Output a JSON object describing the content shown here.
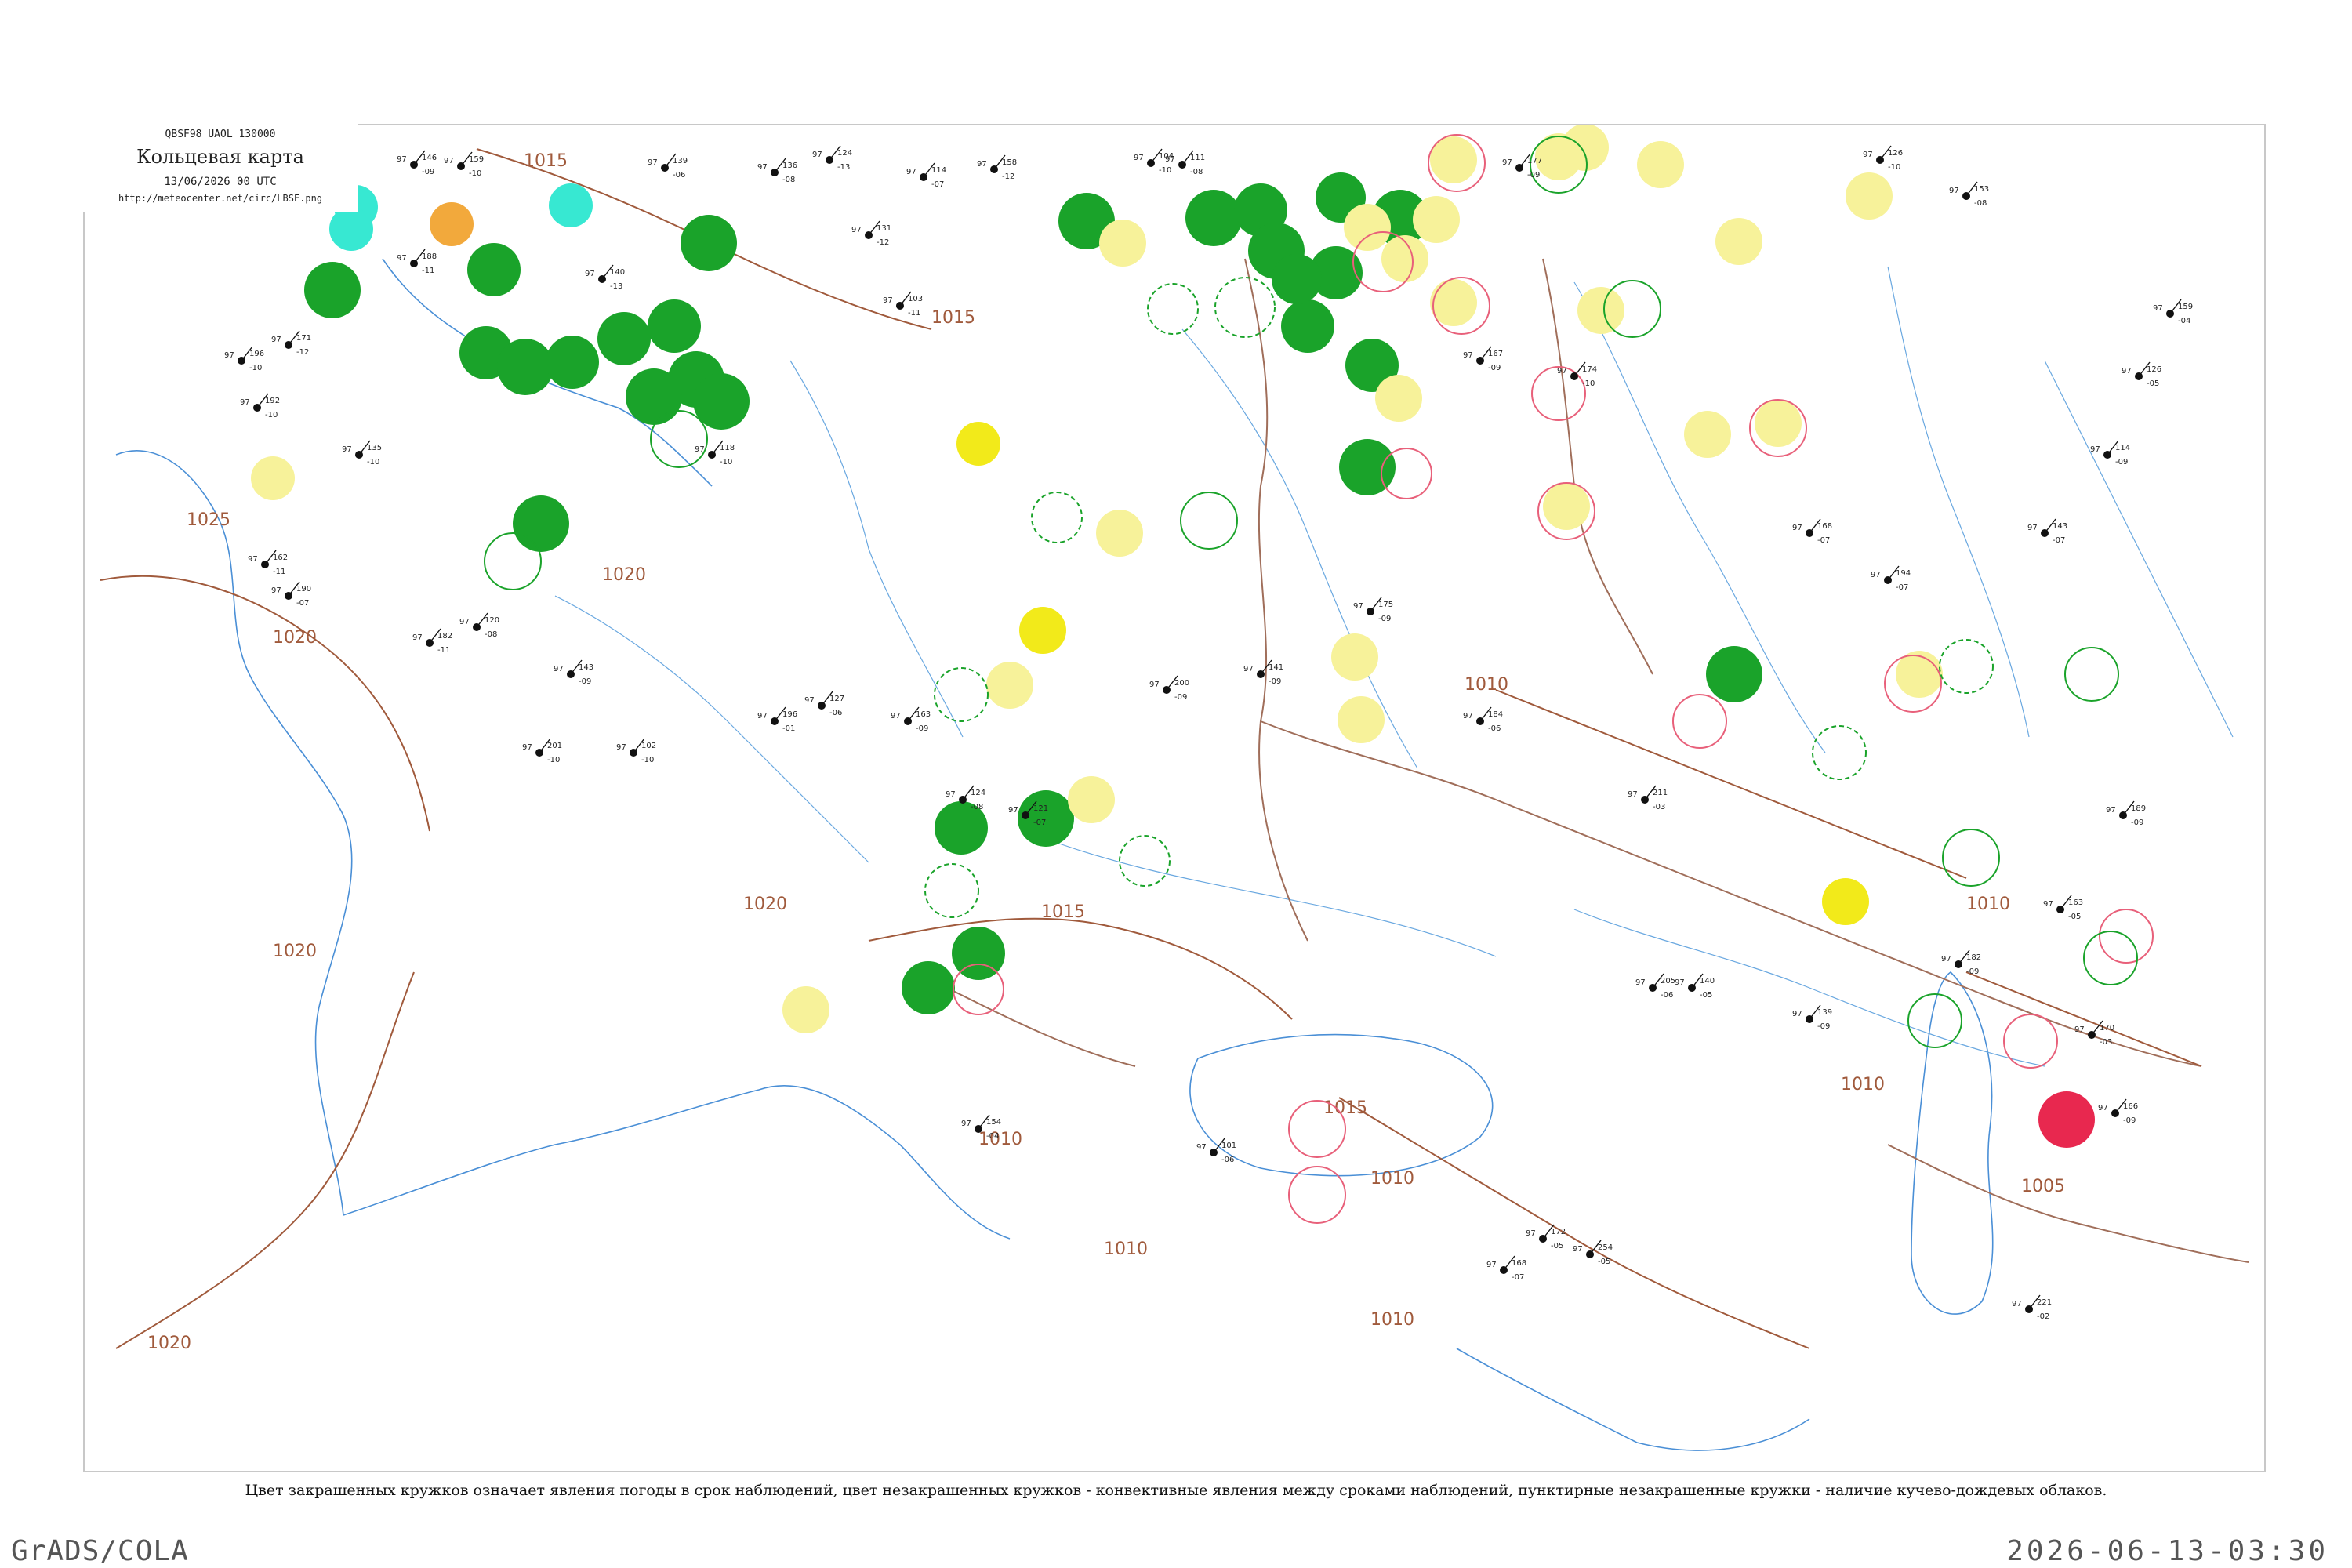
{
  "header": {
    "code": "QBSF98  UAOL  130000",
    "title": "Кольцевая карта",
    "datetime": "13/06/2026 00 UTC",
    "url": "http://meteocenter.net/circ/LBSF.png"
  },
  "caption": "Цвет закрашенных кружков означает явления погоды в срок наблюдений, цвет незакрашенных кружков - конвективные явления между сроками наблюдений, пунктирные незакрашенные кружки - наличие кучево-дождевых облаков.",
  "footer": {
    "software": "GrADS/COLA",
    "timestamp": "2026-06-13-03:30"
  },
  "colors": {
    "rain": "#1aa32a",
    "fog": "#f2ea1a",
    "haze": "#f7f29a",
    "snow": "#37e8d2",
    "dust": "#f2a93c",
    "thunder": "#e8284f",
    "isobar": "#a05a3c",
    "river": "#6aa8e0",
    "coast": "#4a8fd6"
  },
  "isobars": [
    {
      "label": "1015"
    },
    {
      "label": "1015"
    },
    {
      "label": "1015"
    },
    {
      "label": "1015"
    },
    {
      "label": "1020"
    },
    {
      "label": "1020"
    },
    {
      "label": "1020"
    },
    {
      "label": "1020"
    },
    {
      "label": "1020"
    },
    {
      "label": "1025"
    },
    {
      "label": "1010"
    },
    {
      "label": "1010"
    },
    {
      "label": "1010"
    },
    {
      "label": "1010"
    },
    {
      "label": "1010"
    },
    {
      "label": "1010"
    },
    {
      "label": "1010"
    },
    {
      "label": "1005"
    }
  ],
  "stations": [
    {
      "p": "146",
      "t": "09",
      "d": "97"
    },
    {
      "p": "159",
      "t": "10",
      "d": "97"
    },
    {
      "p": "139",
      "t": "06",
      "d": "97"
    },
    {
      "p": "136",
      "t": "08",
      "d": "97"
    },
    {
      "p": "124",
      "t": "13",
      "d": "97"
    },
    {
      "p": "114",
      "t": "07",
      "d": "97"
    },
    {
      "p": "158",
      "t": "12",
      "d": "97"
    },
    {
      "p": "104",
      "t": "10",
      "d": "97"
    },
    {
      "p": "111",
      "t": "08",
      "d": "97"
    },
    {
      "p": "177",
      "t": "09",
      "d": "97"
    },
    {
      "p": "126",
      "t": "10",
      "d": "97"
    },
    {
      "p": "153",
      "t": "08",
      "d": "97"
    },
    {
      "p": "188",
      "t": "11",
      "d": "97"
    },
    {
      "p": "140",
      "t": "13",
      "d": "97"
    },
    {
      "p": "131",
      "t": "12",
      "d": "97"
    },
    {
      "p": "103",
      "t": "11",
      "d": "97"
    },
    {
      "p": "167",
      "t": "09",
      "d": "97"
    },
    {
      "p": "174",
      "t": "10",
      "d": "97"
    },
    {
      "p": "196",
      "t": "10",
      "d": "97"
    },
    {
      "p": "171",
      "t": "12",
      "d": "97"
    },
    {
      "p": "118",
      "t": "10",
      "d": "97"
    },
    {
      "p": "192",
      "t": "10",
      "d": "97"
    },
    {
      "p": "135",
      "t": "10",
      "d": "97"
    },
    {
      "p": "162",
      "t": "11",
      "d": "97"
    },
    {
      "p": "190",
      "t": "07",
      "d": "97"
    },
    {
      "p": "182",
      "t": "11",
      "d": "97"
    },
    {
      "p": "120",
      "t": "08",
      "d": "97"
    },
    {
      "p": "143",
      "t": "09",
      "d": "97"
    },
    {
      "p": "201",
      "t": "10",
      "d": "97"
    },
    {
      "p": "102",
      "t": "10",
      "d": "97"
    },
    {
      "p": "196",
      "t": "01",
      "d": "97"
    },
    {
      "p": "127",
      "t": "06",
      "d": "97"
    },
    {
      "p": "163",
      "t": "09",
      "d": "97"
    },
    {
      "p": "124",
      "t": "08",
      "d": "97"
    },
    {
      "p": "121",
      "t": "07",
      "d": "97"
    },
    {
      "p": "200",
      "t": "09",
      "d": "97"
    },
    {
      "p": "141",
      "t": "09",
      "d": "97"
    },
    {
      "p": "175",
      "t": "09",
      "d": "97"
    },
    {
      "p": "184",
      "t": "06",
      "d": "97"
    },
    {
      "p": "211",
      "t": "03",
      "d": "97"
    },
    {
      "p": "168",
      "t": "07",
      "d": "97"
    },
    {
      "p": "194",
      "t": "07",
      "d": "97"
    },
    {
      "p": "143",
      "t": "07",
      "d": "97"
    },
    {
      "p": "114",
      "t": "09",
      "d": "97"
    },
    {
      "p": "126",
      "t": "05",
      "d": "97"
    },
    {
      "p": "159",
      "t": "04",
      "d": "97"
    },
    {
      "p": "189",
      "t": "09",
      "d": "97"
    },
    {
      "p": "163",
      "t": "05",
      "d": "97"
    },
    {
      "p": "254",
      "t": "05",
      "d": "97"
    },
    {
      "p": "168",
      "t": "07",
      "d": "97"
    },
    {
      "p": "101",
      "t": "06",
      "d": "97"
    },
    {
      "p": "172",
      "t": "05",
      "d": "97"
    },
    {
      "p": "221",
      "t": "02",
      "d": "97"
    },
    {
      "p": "182",
      "t": "09",
      "d": "97"
    },
    {
      "p": "205",
      "t": "06",
      "d": "97"
    },
    {
      "p": "140",
      "t": "05",
      "d": "97"
    },
    {
      "p": "139",
      "t": "09",
      "d": "97"
    },
    {
      "p": "170",
      "t": "03",
      "d": "97"
    },
    {
      "p": "166",
      "t": "09",
      "d": "97"
    },
    {
      "p": "154",
      "t": "04",
      "d": "97"
    }
  ],
  "weather_circles": [
    {
      "kind": "rain"
    },
    {
      "kind": "fog"
    },
    {
      "kind": "haze"
    },
    {
      "kind": "snow"
    },
    {
      "kind": "dust"
    },
    {
      "kind": "thunder"
    },
    {
      "kind": "conv-thunder"
    },
    {
      "kind": "conv-shower"
    },
    {
      "kind": "cb"
    }
  ]
}
